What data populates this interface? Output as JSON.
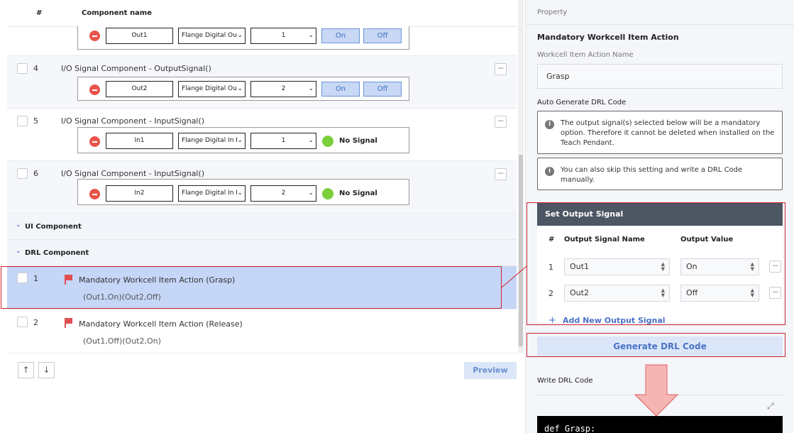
{
  "table_header": {
    "num": "#",
    "component_name": "Component name"
  },
  "rows": [
    {
      "group": {
        "name": "Out1",
        "module": "Flange Digital Ou",
        "index": "1",
        "on": "On",
        "off": "Off"
      }
    },
    {
      "num": "4",
      "title": "I/O Signal Component - OutputSignal()",
      "group": {
        "name": "Out2",
        "module": "Flange Digital Ou",
        "index": "2",
        "on": "On",
        "off": "Off"
      }
    },
    {
      "num": "5",
      "title": "I/O Signal Component - InputSignal()",
      "group": {
        "name": "In1",
        "module": "Flange Digital In I",
        "index": "1",
        "status": "No Signal"
      }
    },
    {
      "num": "6",
      "title": "I/O Signal Component - InputSignal()",
      "group": {
        "name": "In2",
        "module": "Flange Digital In I",
        "index": "2",
        "status": "No Signal"
      }
    }
  ],
  "sections": {
    "ui": "UI Component",
    "drl": "DRL Component"
  },
  "drl_items": [
    {
      "num": "1",
      "title": "Mandatory Workcell Item Action (Grasp)",
      "sub": "(Out1,On)(Out2,Off)"
    },
    {
      "num": "2",
      "title": "Mandatory Workcell Item Action (Release)",
      "sub": "(Out1,Off)(Out2,On)"
    }
  ],
  "nav": {
    "up": "↑",
    "down": "↓",
    "preview": "Preview"
  },
  "property": {
    "header": "Property",
    "title": "Mandatory Workcell Item Action",
    "name_label": "Workcell Item Action Name",
    "name_value": "Grasp",
    "auto_label": "Auto Generate DRL Code",
    "info1": "The output signal(s) selected below will be a mandatory option. Therefore it cannot be deleted when installed on the Teach Pendant.",
    "info2": "You can also skip this setting and write a DRL Code manually.",
    "set_output": {
      "title": "Set Output Signal",
      "col_num": "#",
      "col_name": "Output Signal Name",
      "col_value": "Output Value",
      "rows": [
        {
          "num": "1",
          "name": "Out1",
          "value": "On"
        },
        {
          "num": "2",
          "name": "Out2",
          "value": "Off"
        }
      ],
      "add": "Add New Output Signal"
    },
    "generate": "Generate DRL Code",
    "write_label": "Write DRL Code",
    "code": "def Grasp:"
  },
  "colors": {
    "accent": "#4a72c8",
    "highlight": "#c5d6f7",
    "red_box": "#cc2233",
    "arrow": "#f6b5b5"
  }
}
